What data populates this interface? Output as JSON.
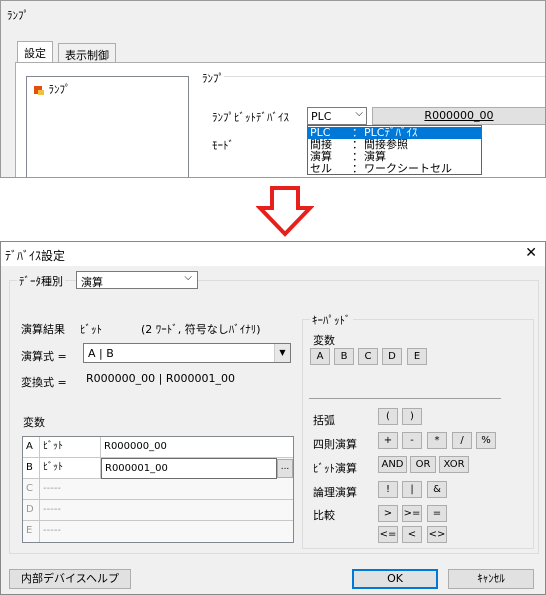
{
  "top": {
    "title": "ﾗﾝﾌﾟ",
    "tabs": [
      "設定",
      "表示制御"
    ],
    "tree_item": "ﾗﾝﾌﾟ",
    "group_label": "ﾗﾝﾌﾟ",
    "bit_device_label": "ﾗﾝﾌﾟﾋﾞｯﾄﾃﾞﾊﾞｲｽ",
    "bit_device_value": "PLC",
    "device_button": "R000000_00",
    "mode_label": "ﾓｰﾄﾞ",
    "dropdown_items": [
      {
        "key": "PLC",
        "sep": "：",
        "desc": "PLCﾃﾞﾊﾞｲｽ",
        "selected": true
      },
      {
        "key": "間接",
        "sep": "：",
        "desc": "間接参照",
        "selected": false
      },
      {
        "key": "演算",
        "sep": "：",
        "desc": "演算",
        "selected": false
      },
      {
        "key": "セル",
        "sep": "：",
        "desc": "ワークシートセル",
        "selected": false
      }
    ]
  },
  "dialog": {
    "title": "ﾃﾞﾊﾞｲｽ設定",
    "close": "✕",
    "data_type_label": "ﾃﾞｰﾀ種別",
    "data_type_value": "演算",
    "result_label": "演算結果",
    "result_type": "ﾋﾞｯﾄ",
    "result_desc": "(2 ﾜｰﾄﾞ, 符号なしﾊﾞｲﾅﾘ)",
    "expr_label": "演算式 =",
    "expr_value": "A | B",
    "conv_label": "変換式 =",
    "conv_value": "R000000_00 | R000001_00",
    "vars_label": "変数",
    "variables": [
      {
        "name": "A",
        "type": "ﾋﾞｯﾄ",
        "device": "R000000_00",
        "active": true
      },
      {
        "name": "B",
        "type": "ﾋﾞｯﾄ",
        "device": "R000001_00",
        "active": true
      },
      {
        "name": "C",
        "type": "-----",
        "device": "",
        "active": false
      },
      {
        "name": "D",
        "type": "-----",
        "device": "",
        "active": false
      },
      {
        "name": "E",
        "type": "-----",
        "device": "",
        "active": false
      }
    ],
    "browse": "...",
    "keypad": {
      "label": "ｷｰﾊﾟｯﾄﾞ",
      "vars_label": "変数",
      "var_keys": [
        "A",
        "B",
        "C",
        "D",
        "E"
      ],
      "paren_label": "括弧",
      "paren_keys": [
        "(",
        ")"
      ],
      "arith_label": "四則演算",
      "arith_keys": [
        "+",
        "-",
        "*",
        "/",
        "%"
      ],
      "bit_label": "ﾋﾞｯﾄ演算",
      "bit_keys": [
        "AND",
        "OR",
        "XOR"
      ],
      "logic_label": "論理演算",
      "logic_keys": [
        "!",
        "|",
        "&"
      ],
      "compare_label": "比較",
      "compare_keys_1": [
        ">",
        ">=",
        "="
      ],
      "compare_keys_2": [
        "<=",
        "<",
        "<>"
      ]
    },
    "help_button": "内部デバイスヘルプ",
    "ok_button": "OK",
    "cancel_button": "ｷｬﾝｾﾙ"
  },
  "colors": {
    "arrow": "#e8201c",
    "selection": "#0078d7",
    "lamp_icon": "#e05010"
  }
}
